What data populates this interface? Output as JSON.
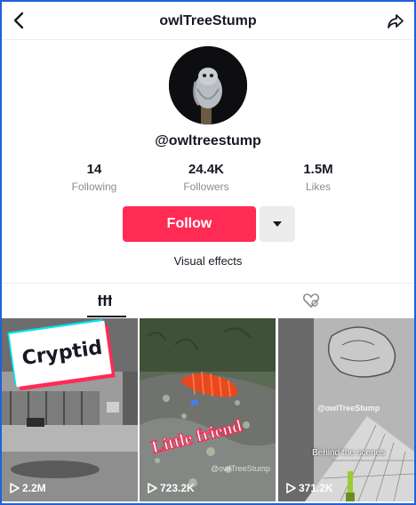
{
  "header": {
    "title": "owlTreeStump"
  },
  "profile": {
    "handle": "@owltreestump",
    "stats": [
      {
        "value": "14",
        "label": "Following"
      },
      {
        "value": "24.4K",
        "label": "Followers"
      },
      {
        "value": "1.5M",
        "label": "Likes"
      }
    ],
    "follow_label": "Follow",
    "bio": "Visual effects"
  },
  "tabs": [
    {
      "icon": "videos-grid-icon",
      "active": true
    },
    {
      "icon": "liked-videos-icon",
      "active": false
    }
  ],
  "videos": [
    {
      "caption": "Cryptid",
      "views": "2.2M"
    },
    {
      "caption": "Little friend",
      "watermark": "@owlTreeStump",
      "views": "723.2K"
    },
    {
      "caption": "Behind the scenes",
      "watermark": "@owlTreeStump",
      "views": "371.2K"
    }
  ],
  "colors": {
    "accent": "#fe2c55",
    "text": "#161823",
    "muted": "#8a8b91",
    "frame": "#1e63d8"
  }
}
